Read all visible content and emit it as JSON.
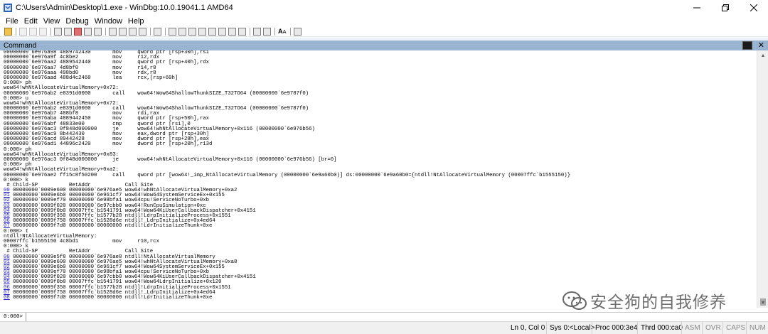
{
  "window": {
    "title": "C:\\Users\\Admin\\Desktop\\1.exe - WinDbg:10.0.19041.1 AMD64",
    "icons": [
      "windbg-app-icon",
      "minimize-icon",
      "restore-icon",
      "close-icon"
    ]
  },
  "menubar": {
    "items": [
      "File",
      "Edit",
      "View",
      "Debug",
      "Window",
      "Help"
    ]
  },
  "toolbar": {
    "font_button_label": "A",
    "font_button_sub": "A"
  },
  "command_window": {
    "title": "Command",
    "prompt": "0:000>",
    "input_value": "",
    "lines": [
      "00000000`6e976a98 4889742430       mov     qword ptr [rsp+30h],rsi",
      "00000000`6e976a9f 4c8be2           mov     r12,rdx",
      "00000000`6e976aa2 4889542440       mov     qword ptr [rsp+40h],rdx",
      "00000000`6e976aa7 4d8bf0           mov     r14,r8",
      "00000000`6e976aaa 498bd0           mov     rdx,r8",
      "00000000`6e976aad 488d4c2460       lea     rcx,[rsp+60h]",
      "0:000> ph",
      "wow64!whNtAllocateVirtualMemory+0x72:",
      "00000000`6e976ab2 e8391d0000       call    wow64!Wow64ShallowThunkSIZE_T32TO64 (00000000`6e9787f0)",
      "0:000> u",
      "wow64!whNtAllocateVirtualMemory+0x72:",
      "00000000`6e976ab2 e8391d0000       call    wow64!Wow64ShallowThunkSIZE_T32TO64 (00000000`6e9787f0)",
      "00000000`6e976ab7 488bf8           mov     rdi,rax",
      "00000000`6e976aba 4889442450       mov     qword ptr [rsp+50h],rax",
      "00000000`6e976abf 48833e00         cmp     qword ptr [rsi],0",
      "00000000`6e976ac3 0f848d000000     je      wow64!whNtAllocateVirtualMemory+0x116 (00000000`6e976b56)",
      "00000000`6e976ac9 8b442430         mov     eax,dword ptr [rsp+30h]",
      "00000000`6e976acd 89442428         mov     dword ptr [rsp+28h],eax",
      "00000000`6e976ad1 44896c2420       mov     dword ptr [rsp+20h],r13d",
      "0:000> ph",
      "wow64!whNtAllocateVirtualMemory+0x83:",
      "00000000`6e976ac3 0f848d000000     je      wow64!whNtAllocateVirtualMemory+0x116 (00000000`6e976b56) [br=0]",
      "0:000> ph",
      "wow64!whNtAllocateVirtualMemory+0xa2:",
      "00000000`6e976ae2 ff15c8f50200     call    qword ptr [wow64!_imp_NtAllocateVirtualMemory (00000000`6e9a60b0)] ds:00000000`6e9a60b0={ntdll!NtAllocateVirtualMemory (00007ffc`b1555150)}",
      "0:000> k",
      " # Child-SP          RetAddr           Call Site",
      "00 00000000`0009e600 00000000`6e976ae5 wow64!whNtAllocateVirtualMemory+0xa2",
      "01 00000000`0009e6b0 00000000`6e961cf7 wow64!Wow64SystemServiceEx+0x155",
      "02 00000000`0009ef70 00000000`6e98bfa1 wow64cpu!ServiceNoTurbo+0xb",
      "03 00000000`0009f020 00000000`6e97cbb0 wow64!RunCpuSimulation+0xc",
      "04 00000000`0009f0b0 00007ffc`b1541791 wow64!Wow64KiUserCallbackDispatcher+0x4151",
      "05 00000000`0009f350 00007ffc`b1577b28 ntdll!LdrpInitializeProcess+0x1551",
      "06 00000000`0009f750 00007ffc`b1528d6e ntdll!_LdrpInitialize+0x4ed64",
      "07 00000000`0009f7d0 00000000`00000000 ntdll!LdrInitializeThunk+0xe",
      "0:000> t",
      "ntdll!NtAllocateVirtualMemory:",
      "00007ffc`b1555150 4c8bd1           mov     r10,rcx",
      "0:000> k",
      " # Child-SP          RetAddr           Call Site",
      "00 00000000`0009e5f8 00000000`6e976ae8 ntdll!NtAllocateVirtualMemory",
      "01 00000000`0009e600 00000000`6e976ae5 wow64!whNtAllocateVirtualMemory+0xa8",
      "02 00000000`0009e6b0 00000000`6e961cf7 wow64!Wow64SystemServiceEx+0x155",
      "03 00000000`0009ef70 00000000`6e98bfa1 wow64cpu!ServiceNoTurbo+0xb",
      "04 00000000`0009f020 00000000`6e97cbb0 wow64!Wow64KiUserCallbackDispatcher+0x4151",
      "05 00000000`0009f0b0 00007ffc`b1541791 wow64!Wow64LdrpInitialize+0x120",
      "06 00000000`0009f350 00007ffc`b1577b28 ntdll!LdrpInitializeProcess+0x1551",
      "07 00000000`0009f750 00007ffc`b1528d6e ntdll!_LdrpInitialize+0x4ed64",
      "08 00000000`0009f7d0 00000000`00000000 ntdll!LdrInitializeThunk+0xe"
    ]
  },
  "statusbar": {
    "cells": [
      {
        "label": "Ln 0, Col 0",
        "enabled": true
      },
      {
        "label": "Sys 0:<Local>",
        "enabled": true
      },
      {
        "label": "Proc 000:3e4",
        "enabled": true
      },
      {
        "label": "Thrd 000:ca0",
        "enabled": true
      },
      {
        "label": "ASM",
        "enabled": false
      },
      {
        "label": "OVR",
        "enabled": false
      },
      {
        "label": "CAPS",
        "enabled": false
      },
      {
        "label": "NUM",
        "enabled": false
      }
    ]
  },
  "watermark": {
    "text": "安全狗的自我修养"
  }
}
